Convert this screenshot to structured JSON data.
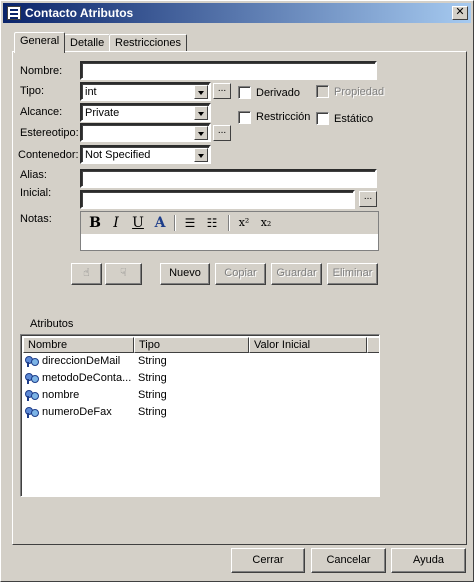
{
  "window": {
    "title": "Contacto Atributos",
    "close_label": "✕"
  },
  "tabs": [
    "General",
    "Detalle",
    "Restricciones"
  ],
  "form": {
    "nombre_label": "Nombre:",
    "nombre_value": "",
    "tipo_label": "Tipo:",
    "tipo_value": "int",
    "alcance_label": "Alcance:",
    "alcance_value": "Private",
    "estereotipo_label": "Estereotipo:",
    "estereotipo_value": "",
    "contenedor_label": "Contenedor:",
    "contenedor_value": "Not Specified",
    "alias_label": "Alias:",
    "alias_value": "",
    "inicial_label": "Inicial:",
    "inicial_value": "",
    "notas_label": "Notas:",
    "dots_label": "...",
    "derivado_label": "Derivado",
    "propiedad_label": "Propiedad",
    "restriccion_label": "Restricción",
    "estatico_label": "Estático"
  },
  "actions": {
    "nuevo": "Nuevo",
    "copiar": "Copiar",
    "guardar": "Guardar",
    "eliminar": "Eliminar"
  },
  "attributes": {
    "group_label": "Atributos",
    "columns": [
      "Nombre",
      "Tipo",
      "Valor Inicial"
    ],
    "rows": [
      {
        "nombre": "direccionDeMail",
        "tipo": "String",
        "valor": ""
      },
      {
        "nombre": "metodoDeConta...",
        "tipo": "String",
        "valor": ""
      },
      {
        "nombre": "nombre",
        "tipo": "String",
        "valor": ""
      },
      {
        "nombre": "numeroDeFax",
        "tipo": "String",
        "valor": ""
      }
    ]
  },
  "footer": {
    "cerrar": "Cerrar",
    "cancelar": "Cancelar",
    "ayuda": "Ayuda"
  },
  "colors": {
    "titlebar_start": "#0a246a",
    "titlebar_end": "#a6caf0",
    "face": "#d4d0c8"
  }
}
